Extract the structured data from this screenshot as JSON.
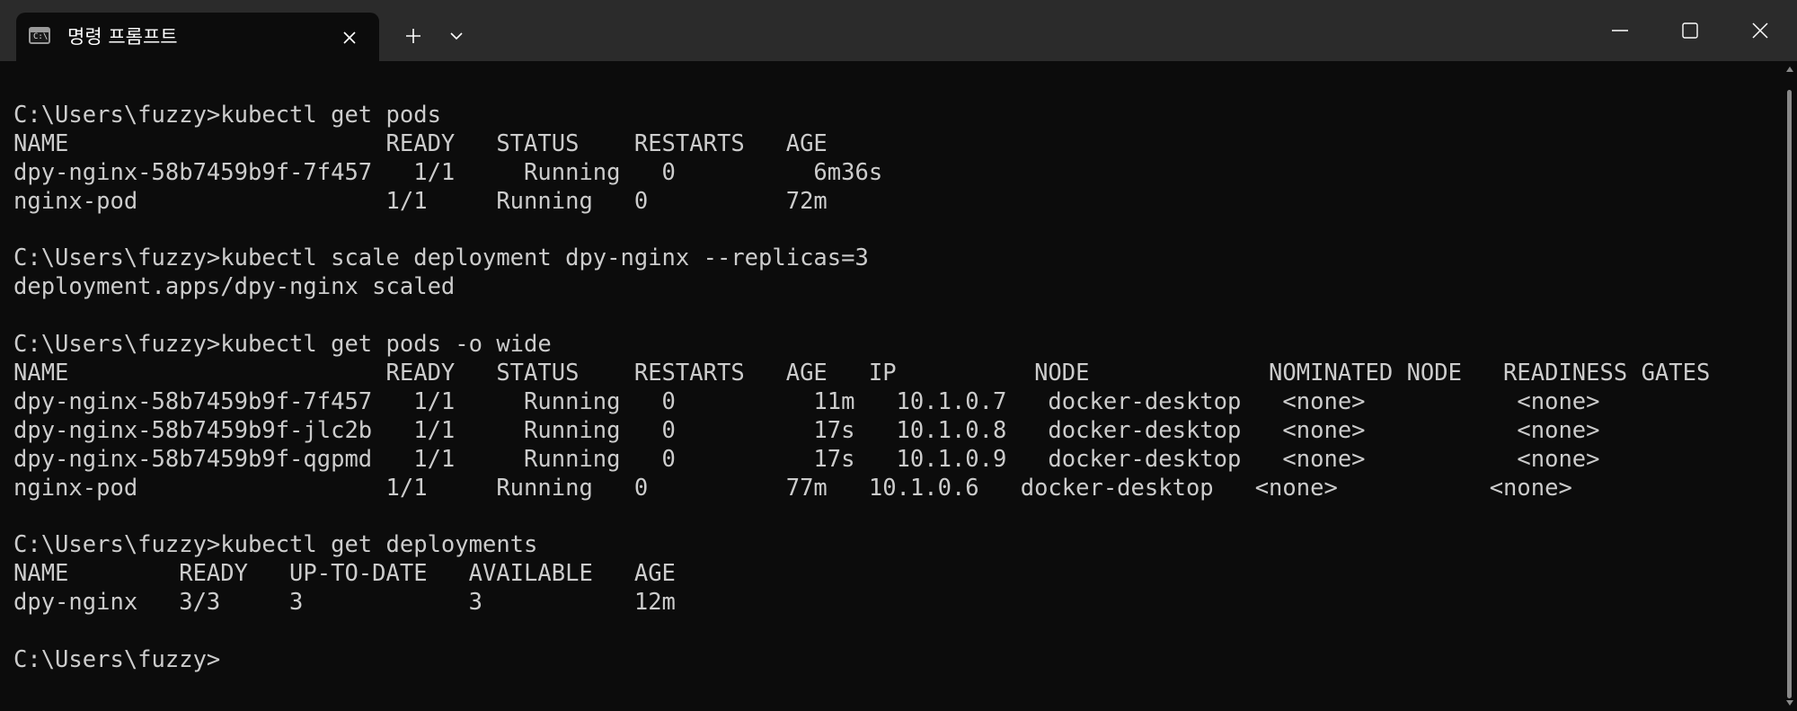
{
  "window": {
    "tab_title": "명령 프롬프트",
    "tab_icon": "command-prompt-icon",
    "tab_close_icon": "close-icon",
    "new_tab_icon": "plus-icon",
    "dropdown_icon": "chevron-down-icon",
    "minimize_icon": "minimize-icon",
    "maximize_icon": "maximize-icon",
    "close_icon": "close-icon",
    "colors": {
      "titlebar": "#2b2b2b",
      "terminal_bg": "#0c0c0c",
      "terminal_fg": "#cccccc"
    }
  },
  "terminal": {
    "lines": [
      "C:\\Users\\fuzzy>kubectl get pods",
      "NAME                       READY   STATUS    RESTARTS   AGE",
      "dpy-nginx-58b7459b9f-7f457   1/1     Running   0          6m36s",
      "nginx-pod                  1/1     Running   0          72m",
      "",
      "C:\\Users\\fuzzy>kubectl scale deployment dpy-nginx --replicas=3",
      "deployment.apps/dpy-nginx scaled",
      "",
      "C:\\Users\\fuzzy>kubectl get pods -o wide",
      "NAME                       READY   STATUS    RESTARTS   AGE   IP          NODE             NOMINATED NODE   READINESS GATES",
      "dpy-nginx-58b7459b9f-7f457   1/1     Running   0          11m   10.1.0.7   docker-desktop   <none>           <none>",
      "dpy-nginx-58b7459b9f-jlc2b   1/1     Running   0          17s   10.1.0.8   docker-desktop   <none>           <none>",
      "dpy-nginx-58b7459b9f-qgpmd   1/1     Running   0          17s   10.1.0.9   docker-desktop   <none>           <none>",
      "nginx-pod                  1/1     Running   0          77m   10.1.0.6   docker-desktop   <none>           <none>",
      "",
      "C:\\Users\\fuzzy>kubectl get deployments",
      "NAME        READY   UP-TO-DATE   AVAILABLE   AGE",
      "dpy-nginx   3/3     3            3           12m",
      "",
      "C:\\Users\\fuzzy>"
    ]
  }
}
